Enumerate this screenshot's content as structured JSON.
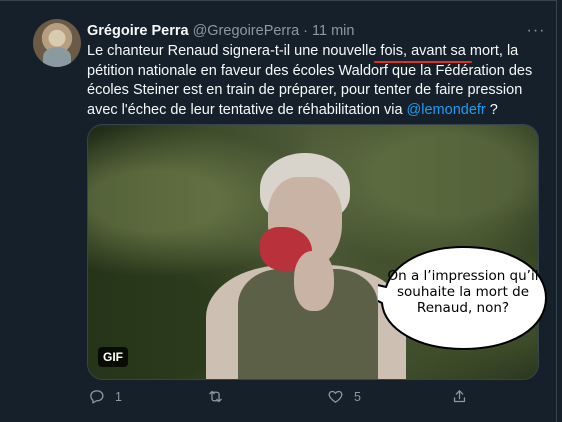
{
  "tweet": {
    "author_name": "Grégoire Perra",
    "author_handle": "@GregoirePerra",
    "separator": "·",
    "time": "11 min",
    "more_label": "···",
    "text_parts": {
      "p1": "Le chanteur Renaud signera-t-il une nouvelle ",
      "u1": "fois",
      "p2": ", ",
      "u2": "avant sa mort",
      "p3": ", la pétition nationale en faveur des écoles Waldorf que la Fédération des écoles Steiner est en train de préparer, pour tenter de faire pression avec l'échec de leur tentative de réhabilitation via ",
      "mention": "@lemondefr",
      "p4": " ?"
    },
    "underline_color": "#e03020",
    "media": {
      "badge": "GIF",
      "speech_bubble": "On a l’impression qu’il souhaite la mort de Renaud, non?"
    },
    "actions": {
      "reply_count": "1",
      "retweet_count": "",
      "like_count": "5"
    },
    "colors": {
      "background": "#15202b",
      "text": "#f7f9f9",
      "secondary": "#8b98a5",
      "link": "#1d9bf0"
    }
  }
}
